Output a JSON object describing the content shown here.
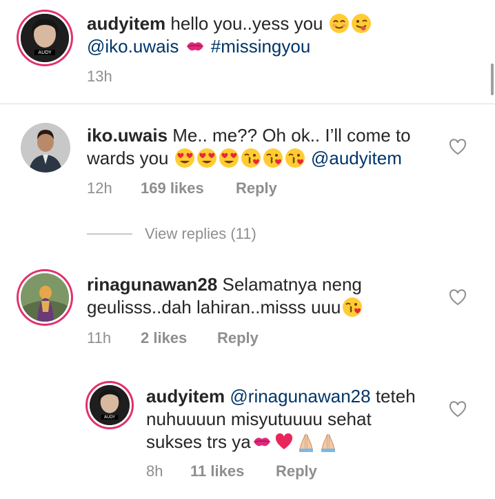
{
  "caption": {
    "username": "audyitem",
    "text": " hello you..yess you ",
    "mention": "@iko.uwais",
    "hashtag": "#missingyou",
    "time": "13h",
    "avatar_label": "AUDY"
  },
  "comments": [
    {
      "username": "iko.uwais",
      "text_line1": " Me.. me?? Oh ok.. I’ll come to",
      "text_line2": "wards you ",
      "mention": "@audyitem",
      "time": "12h",
      "likes": "169 likes",
      "reply": "Reply",
      "view_replies": "View replies (11)"
    },
    {
      "username": "rinagunawan28",
      "text_line1": " Selamatnya neng",
      "text_line2": "geulisss..dah  lahiran..misss uuu",
      "time": "11h",
      "likes": "2 likes",
      "reply": "Reply"
    },
    {
      "username": "audyitem",
      "mention": "@rinagunawan28",
      "text_line1_rest": " teteh",
      "text_line2": "nuhuuuun misyutuuuu sehat",
      "text_line3": "sukses trs ya",
      "time": "8h",
      "likes": "11 likes",
      "reply": "Reply",
      "avatar_label": "AUDY"
    }
  ],
  "colors": {
    "story_ring": "#e1306c",
    "link": "#003569",
    "muted": "#8e8e8e",
    "divider": "#dbdbdb"
  },
  "icons": [
    "smiling-emoji-icon",
    "wink-tongue-emoji-icon",
    "kiss-mark-icon",
    "heart-eyes-emoji-icon",
    "kissing-heart-emoji-icon",
    "red-heart-icon",
    "folded-hands-icon",
    "heart-outline-icon"
  ]
}
